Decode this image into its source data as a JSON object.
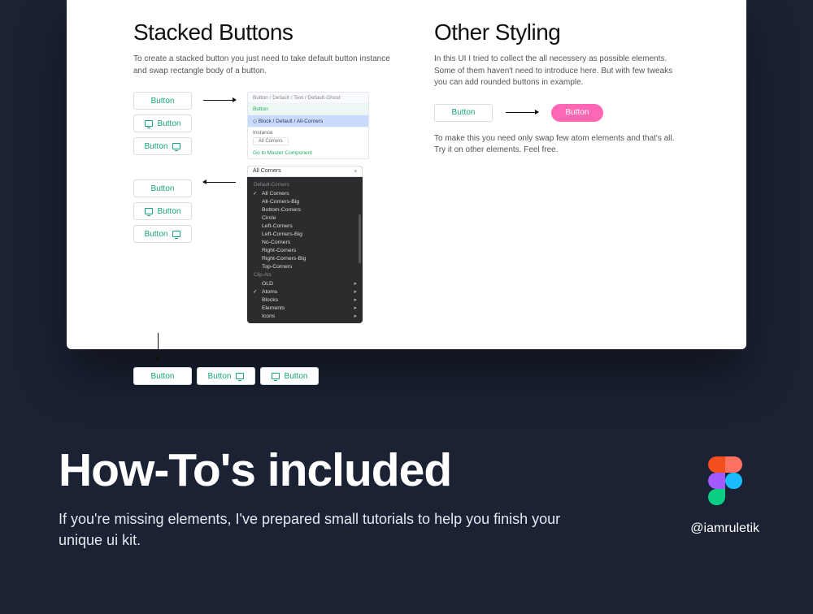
{
  "left": {
    "title": "Stacked Buttons",
    "desc": "To create a stacked button you just need to take default button instance and swap rectangle body of a button.",
    "buttons_set1": [
      "Button",
      "Button",
      "Button"
    ],
    "buttons_set2": [
      "Button",
      "Button",
      "Button"
    ],
    "buttons_row": [
      "Button",
      "Button",
      "Button"
    ]
  },
  "panel": {
    "breadcrumb": "Button / Default / Text / Default-Ghost",
    "button_label": "Button",
    "block_line": "Block / Default / All-Corners",
    "instance_label": "Instance",
    "level1": "All Corners",
    "master_line": "Go to Master Component",
    "dropdown_header": "All Corners",
    "cat1": "Default-Corners",
    "items1": [
      "All Corners",
      "All-Corners-Big",
      "Bottom-Corners",
      "Circle",
      "Left-Corners",
      "Left-Corners-Big",
      "No-Corners",
      "Right-Corners",
      "Right-Corners-Big",
      "Top-Corners"
    ],
    "cat2": "Clip-Ats",
    "items2": [
      "OLD",
      "Atoms",
      "Blocks",
      "Elements",
      "Icons"
    ]
  },
  "right": {
    "title": "Other Styling",
    "desc": "In this UI I tried to collect the all necessery as possible elements. Some of them haven't need to introduce here. But with few tweaks you can add rounded buttons in example.",
    "plain_button": "Button",
    "pill_button": "Button",
    "note": "To make this you need only swap few atom elements and that's all.\nTry it on other elements. Feel free."
  },
  "hero": {
    "title": "How-To's included",
    "subtitle": "If you're missing elements, I've prepared small tutorials to help you finish your unique ui kit."
  },
  "brand": {
    "handle": "@iamruletik"
  }
}
